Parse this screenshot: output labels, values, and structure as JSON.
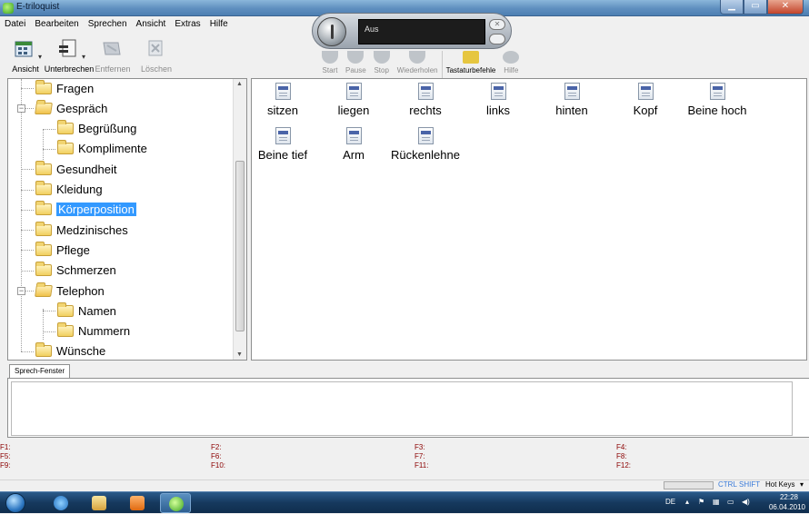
{
  "window": {
    "title": "E-triloquist"
  },
  "menu": [
    "Datei",
    "Bearbeiten",
    "Sprechen",
    "Ansicht",
    "Extras",
    "Hilfe"
  ],
  "toolbar": {
    "ansicht": "Ansicht",
    "unterbrechen": "Unterbrechen",
    "entfernen": "Entfernen",
    "loeschen": "Löschen"
  },
  "speech_widget": {
    "status": "Aus"
  },
  "playback": {
    "start": "Start",
    "pause": "Pause",
    "stop": "Stop",
    "wiederholen": "Wiederholen",
    "tastaturbefehle": "Tastaturbefehle",
    "hilfe": "Hilfe"
  },
  "tree": [
    {
      "label": "Fragen",
      "level": 0,
      "expander": ""
    },
    {
      "label": "Gespräch",
      "level": 0,
      "expander": "−",
      "open": true
    },
    {
      "label": "Begrüßung",
      "level": 1,
      "expander": ""
    },
    {
      "label": "Komplimente",
      "level": 1,
      "expander": ""
    },
    {
      "label": "Gesundheit",
      "level": 0,
      "expander": ""
    },
    {
      "label": "Kleidung",
      "level": 0,
      "expander": ""
    },
    {
      "label": "Körperposition",
      "level": 0,
      "expander": "",
      "selected": true
    },
    {
      "label": "Medzinisches",
      "level": 0,
      "expander": ""
    },
    {
      "label": "Pflege",
      "level": 0,
      "expander": ""
    },
    {
      "label": "Schmerzen",
      "level": 0,
      "expander": ""
    },
    {
      "label": "Telephon",
      "level": 0,
      "expander": "−",
      "open": true
    },
    {
      "label": "Namen",
      "level": 1,
      "expander": ""
    },
    {
      "label": "Nummern",
      "level": 1,
      "expander": ""
    },
    {
      "label": "Wünsche",
      "level": 0,
      "expander": ""
    }
  ],
  "items": [
    "sitzen",
    "liegen",
    "rechts",
    "links",
    "hinten",
    "Kopf",
    "Beine hoch",
    "Beine tief",
    "Arm",
    "Rückenlehne"
  ],
  "speech_window": {
    "tab_label": "Sprech-Fenster",
    "text": ""
  },
  "function_keys": [
    "F1:",
    "F2:",
    "F3:",
    "F4:",
    "F5:",
    "F6:",
    "F7:",
    "F8:",
    "F9:",
    "F10:",
    "F11:",
    "F12:"
  ],
  "status": {
    "ctrl": "CTRL",
    "shift": "SHIFT",
    "hotkeys": "Hot Keys"
  },
  "taskbar": {
    "lang": "DE",
    "time": "22:28",
    "date": "06.04.2010"
  },
  "colors": {
    "selection": "#3399ff",
    "fkey_text": "#8b0000",
    "taskbar": "#16395e"
  }
}
